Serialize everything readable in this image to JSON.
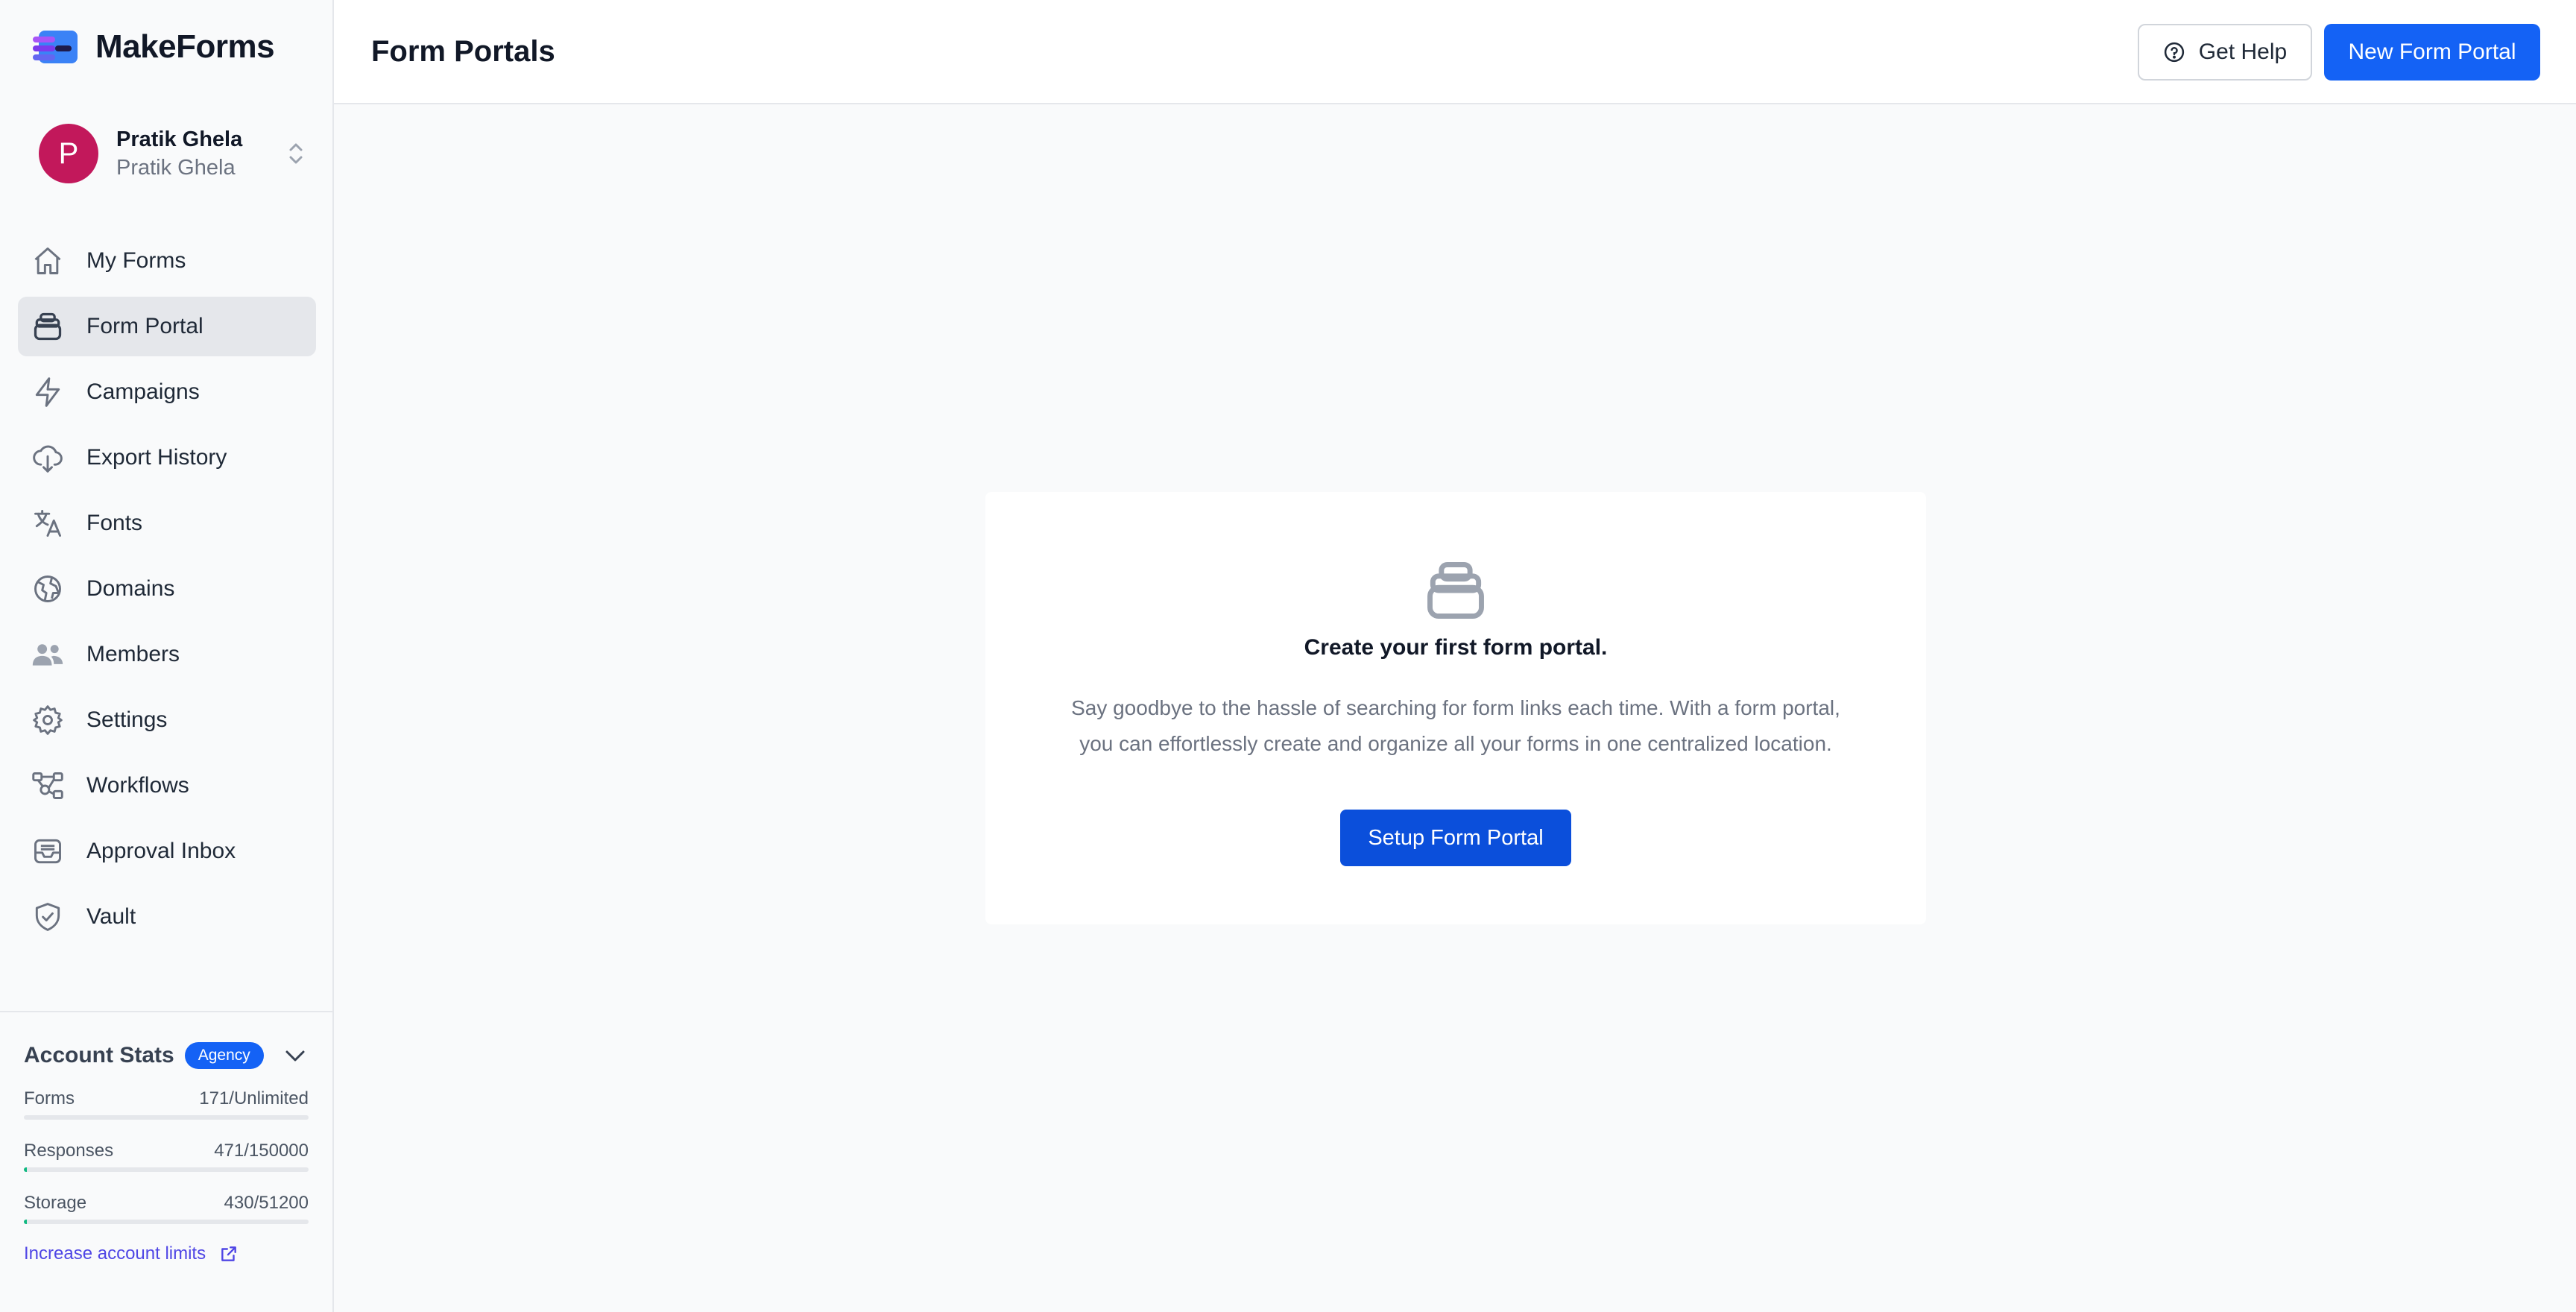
{
  "brand": {
    "name": "MakeForms",
    "logo_icon": "makeforms-logo-icon"
  },
  "account": {
    "avatar_initial": "P",
    "avatar_color": "#c2185b",
    "name": "Pratik Ghela",
    "subtitle": "Pratik Ghela"
  },
  "nav": {
    "items": [
      {
        "label": "My Forms",
        "icon": "home-icon",
        "active": false
      },
      {
        "label": "Form Portal",
        "icon": "portal-icon",
        "active": true
      },
      {
        "label": "Campaigns",
        "icon": "lightning-icon",
        "active": false
      },
      {
        "label": "Export History",
        "icon": "cloud-download-icon",
        "active": false
      },
      {
        "label": "Fonts",
        "icon": "translate-icon",
        "active": false
      },
      {
        "label": "Domains",
        "icon": "globe-icon",
        "active": false
      },
      {
        "label": "Members",
        "icon": "users-icon",
        "active": false
      },
      {
        "label": "Settings",
        "icon": "gear-icon",
        "active": false
      },
      {
        "label": "Workflows",
        "icon": "workflow-icon",
        "active": false
      },
      {
        "label": "Approval Inbox",
        "icon": "inbox-icon",
        "active": false
      },
      {
        "label": "Vault",
        "icon": "shield-check-icon",
        "active": false
      }
    ]
  },
  "stats": {
    "title": "Account Stats",
    "badge": "Agency",
    "rows": [
      {
        "label": "Forms",
        "value": "171/Unlimited",
        "fraction": 0
      },
      {
        "label": "Responses",
        "value": "471/150000",
        "fraction": 0.003
      },
      {
        "label": "Storage",
        "value": "430/51200",
        "fraction": 0.008
      }
    ],
    "increase_link": "Increase account limits"
  },
  "header": {
    "title": "Form Portals",
    "help_label": "Get Help",
    "new_label": "New Form Portal"
  },
  "empty_state": {
    "title": "Create your first form portal.",
    "desc_line1": "Say goodbye to the hassle of searching for form links each time. With a form portal,",
    "desc_line2": "you can effortlessly create and organize all your forms in one centralized location.",
    "button": "Setup Form Portal"
  },
  "colors": {
    "accent": "#1462f5",
    "setup_button": "#0b4fdb",
    "progress": "#10b981"
  }
}
